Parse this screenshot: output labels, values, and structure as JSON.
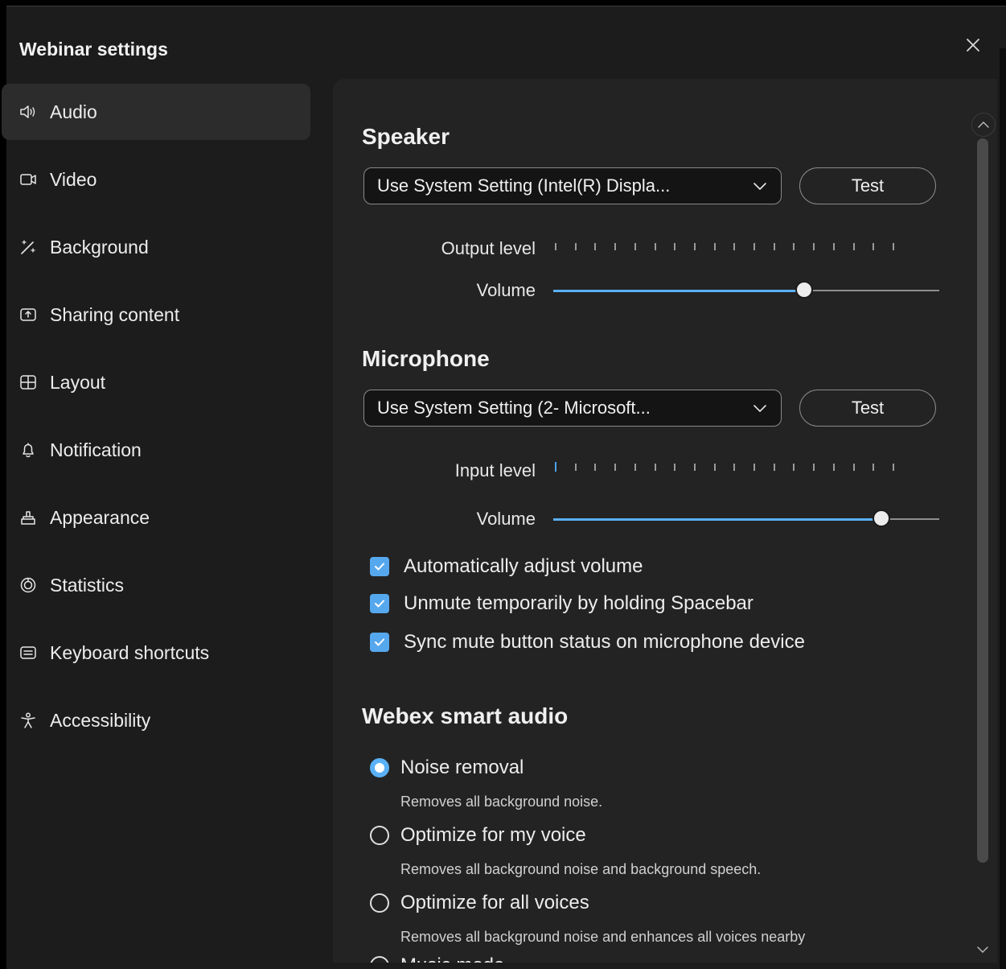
{
  "window": {
    "title": "Webinar settings"
  },
  "nav": {
    "items": [
      {
        "label": "Audio",
        "icon": "speaker-icon",
        "active": true
      },
      {
        "label": "Video",
        "icon": "video-camera-icon"
      },
      {
        "label": "Background",
        "icon": "magic-wand-icon"
      },
      {
        "label": "Sharing content",
        "icon": "share-screen-icon"
      },
      {
        "label": "Layout",
        "icon": "layout-grid-icon"
      },
      {
        "label": "Notification",
        "icon": "bell-icon"
      },
      {
        "label": "Appearance",
        "icon": "paint-brush-icon"
      },
      {
        "label": "Statistics",
        "icon": "chart-dial-icon"
      },
      {
        "label": "Keyboard shortcuts",
        "icon": "keyboard-icon"
      },
      {
        "label": "Accessibility",
        "icon": "accessibility-person-icon"
      }
    ]
  },
  "speaker": {
    "heading": "Speaker",
    "device": "Use System Setting (Intel(R) Displa...",
    "test_label": "Test",
    "output_level_label": "Output level",
    "output_level_active_ticks": 0,
    "volume_label": "Volume",
    "volume_fraction": 0.65
  },
  "microphone": {
    "heading": "Microphone",
    "device": "Use System Setting (2- Microsoft...",
    "test_label": "Test",
    "input_level_label": "Input level",
    "input_level_active_ticks": 1,
    "volume_label": "Volume",
    "volume_fraction": 0.85,
    "options": [
      {
        "label": "Automatically adjust volume",
        "checked": true
      },
      {
        "label": "Unmute temporarily by holding Spacebar",
        "checked": true
      },
      {
        "label": "Sync mute button status on microphone device",
        "checked": true
      }
    ]
  },
  "smart_audio": {
    "heading": "Webex smart audio",
    "modes": [
      {
        "label": "Noise removal",
        "desc": "Removes all background noise.",
        "selected": true
      },
      {
        "label": "Optimize for my voice",
        "desc": "Removes all background noise and background speech.",
        "selected": false
      },
      {
        "label": "Optimize for all voices",
        "desc": "Removes all background noise and enhances all voices nearby",
        "selected": false
      },
      {
        "label": "Music mode",
        "desc": "",
        "selected": false
      }
    ]
  },
  "colors": {
    "accent": "#5ab0f5",
    "background": "#1c1c1c",
    "panel": "#232323"
  }
}
